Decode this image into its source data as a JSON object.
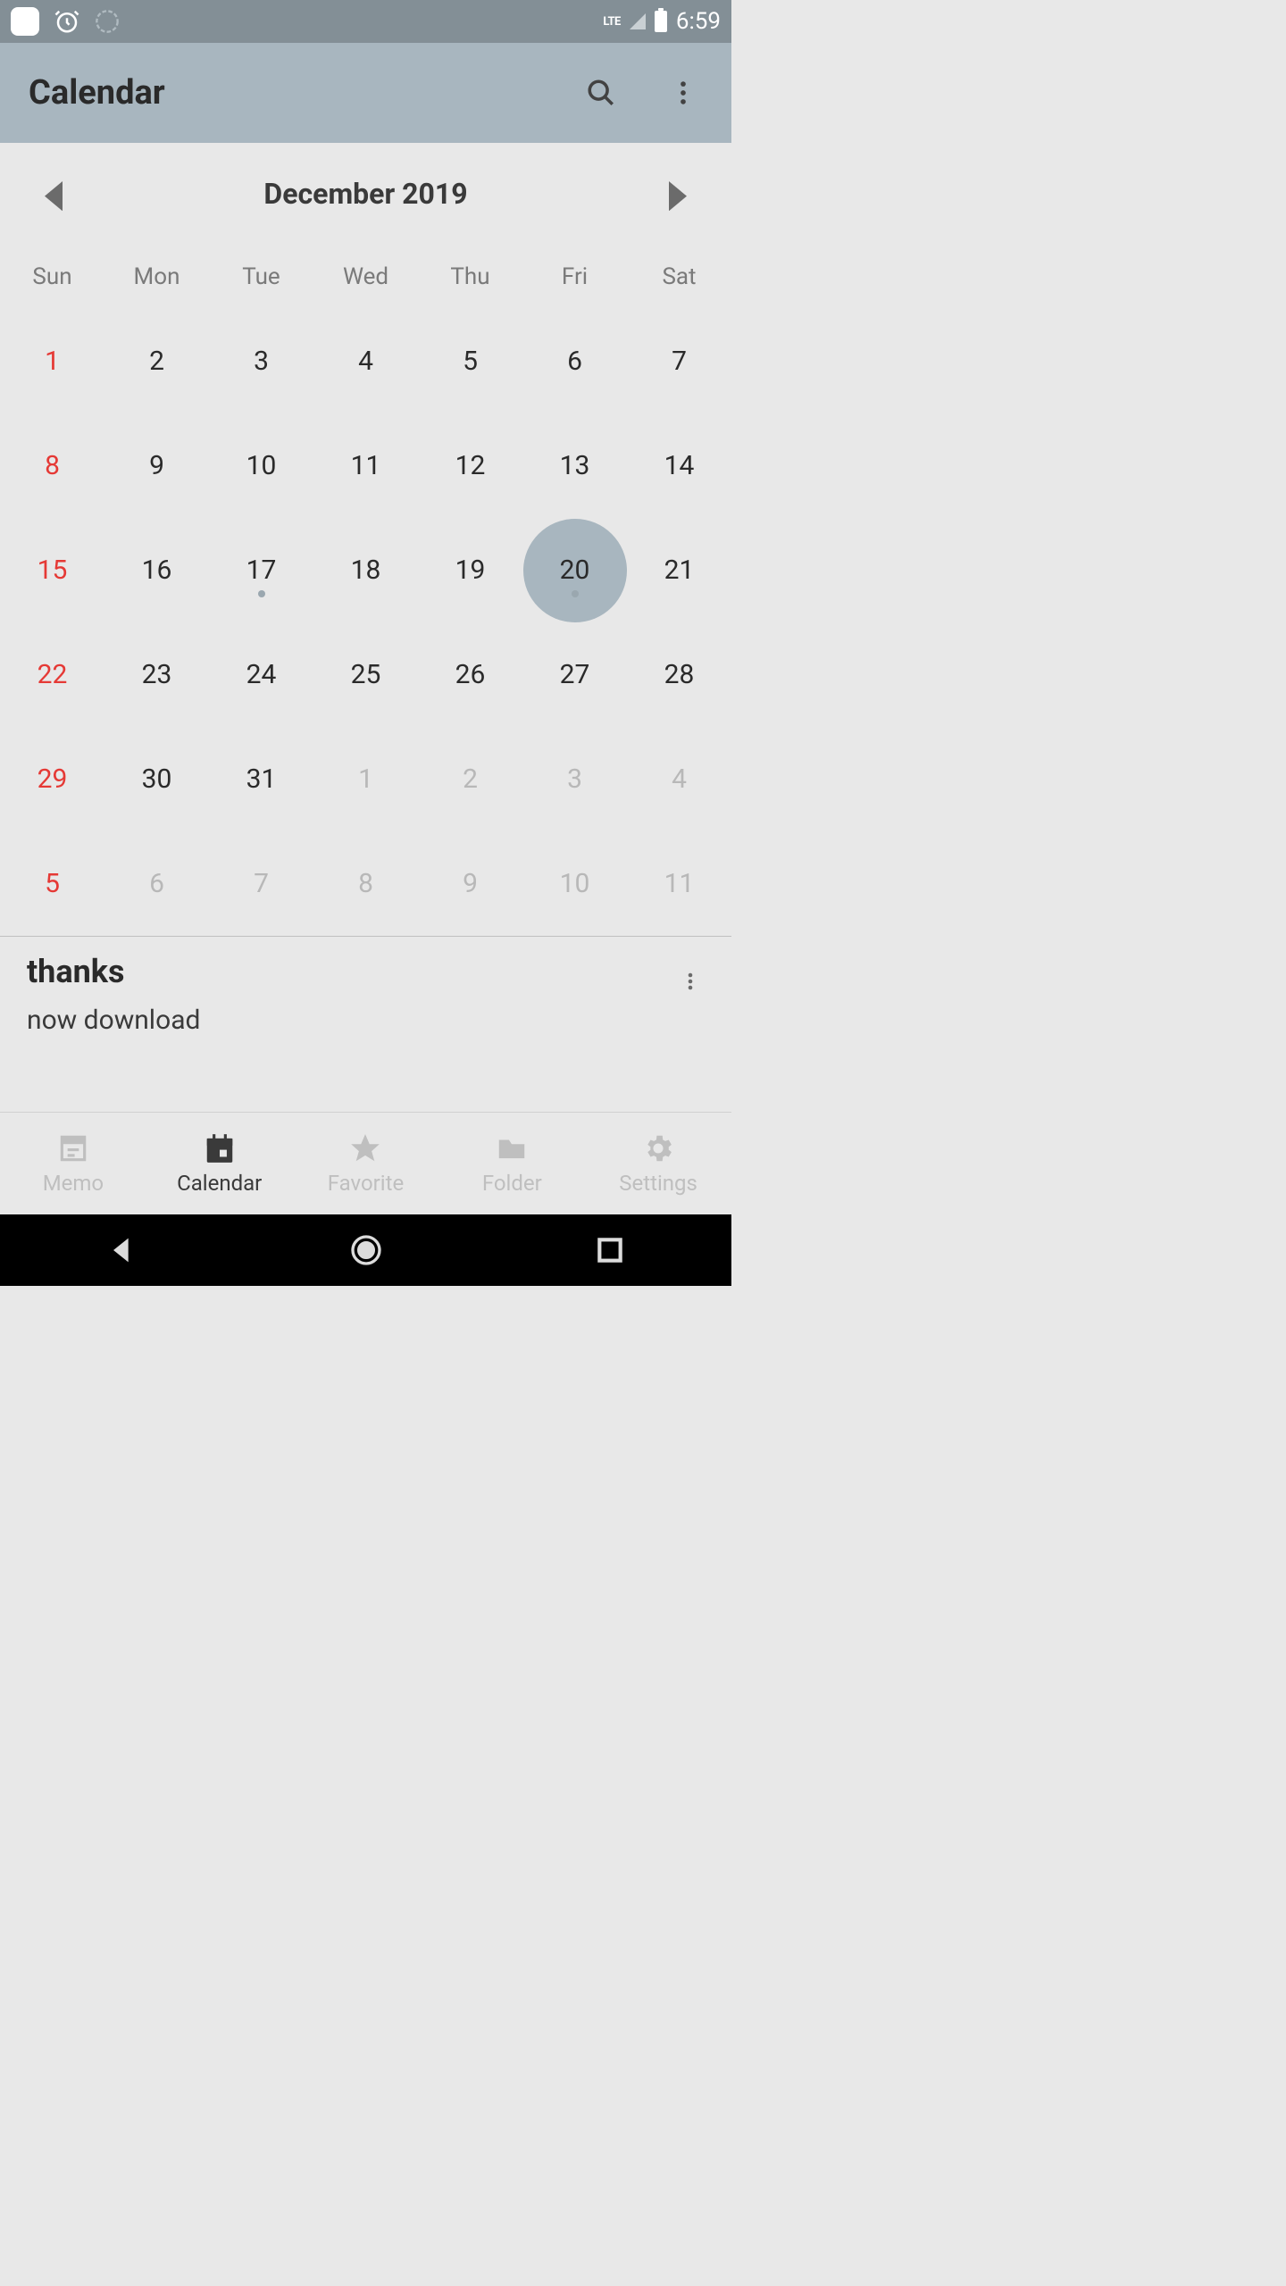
{
  "status": {
    "time": "6:59",
    "lte": "LTE"
  },
  "appbar": {
    "title": "Calendar"
  },
  "month": {
    "label": "December 2019"
  },
  "dow": [
    "Sun",
    "Mon",
    "Tue",
    "Wed",
    "Thu",
    "Fri",
    "Sat"
  ],
  "days": [
    {
      "n": "1",
      "sun": true
    },
    {
      "n": "2"
    },
    {
      "n": "3"
    },
    {
      "n": "4"
    },
    {
      "n": "5"
    },
    {
      "n": "6"
    },
    {
      "n": "7"
    },
    {
      "n": "8",
      "sun": true
    },
    {
      "n": "9"
    },
    {
      "n": "10"
    },
    {
      "n": "11"
    },
    {
      "n": "12"
    },
    {
      "n": "13"
    },
    {
      "n": "14"
    },
    {
      "n": "15",
      "sun": true
    },
    {
      "n": "16"
    },
    {
      "n": "17",
      "dot": true
    },
    {
      "n": "18"
    },
    {
      "n": "19"
    },
    {
      "n": "20",
      "selected": true,
      "dot": true
    },
    {
      "n": "21"
    },
    {
      "n": "22",
      "sun": true
    },
    {
      "n": "23"
    },
    {
      "n": "24"
    },
    {
      "n": "25"
    },
    {
      "n": "26"
    },
    {
      "n": "27"
    },
    {
      "n": "28"
    },
    {
      "n": "29",
      "sun": true
    },
    {
      "n": "30"
    },
    {
      "n": "31"
    },
    {
      "n": "1",
      "dim": true
    },
    {
      "n": "2",
      "dim": true
    },
    {
      "n": "3",
      "dim": true
    },
    {
      "n": "4",
      "dim": true
    },
    {
      "n": "5",
      "sun": true,
      "dimsun": true
    },
    {
      "n": "6",
      "dim": true
    },
    {
      "n": "7",
      "dim": true
    },
    {
      "n": "8",
      "dim": true
    },
    {
      "n": "9",
      "dim": true
    },
    {
      "n": "10",
      "dim": true
    },
    {
      "n": "11",
      "dim": true
    }
  ],
  "event": {
    "title": "thanks",
    "subtitle": "now download"
  },
  "nav": [
    {
      "label": "Memo"
    },
    {
      "label": "Calendar"
    },
    {
      "label": "Favorite"
    },
    {
      "label": "Folder"
    },
    {
      "label": "Settings"
    }
  ]
}
